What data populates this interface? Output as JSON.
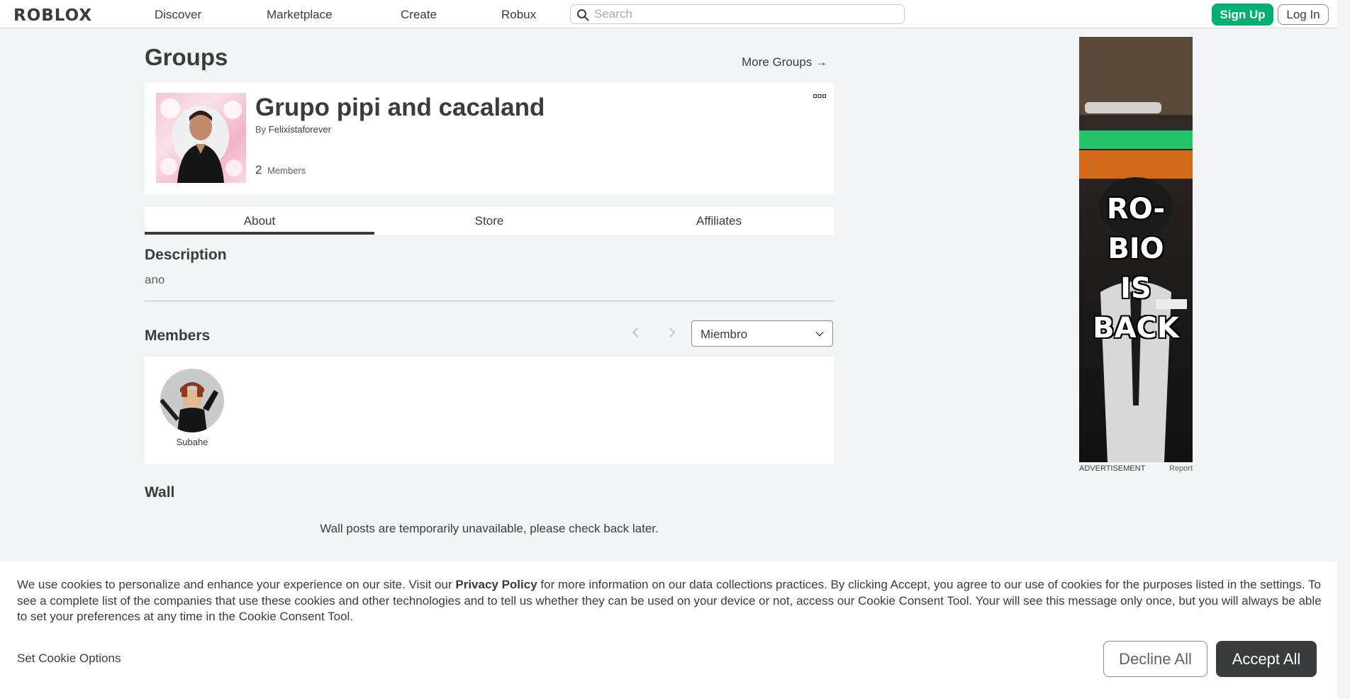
{
  "topnav": {
    "logo_text": "ROBLOX",
    "links": [
      "Discover",
      "Marketplace",
      "Create",
      "Robux"
    ],
    "search_placeholder": "Search",
    "search_value": "",
    "signup_label": "Sign Up",
    "login_label": "Log In"
  },
  "page": {
    "title": "Groups",
    "more_groups_label": "More Groups →"
  },
  "group": {
    "name": "Grupo pipi and cacaland",
    "by_label": "By",
    "owner": "Felixistaforever",
    "member_count": "2",
    "members_label": "Members"
  },
  "tabs": [
    "About",
    "Store",
    "Affiliates"
  ],
  "about": {
    "description_title": "Description",
    "description_text": "ano",
    "members_title": "Members",
    "role_selected": "Miembro",
    "members": [
      {
        "name": "Subahe"
      }
    ],
    "wall_title": "Wall",
    "wall_message": "Wall posts are temporarily unavailable, please check back later."
  },
  "ad": {
    "headline_lines": [
      "RO-BIO",
      "IS",
      "BACK"
    ],
    "label": "ADVERTISEMENT",
    "report": "Report"
  },
  "cookie": {
    "text_pre": "We use cookies to personalize and enhance your experience on our site. Visit our ",
    "privacy_link": "Privacy Policy",
    "text_post": " for more information on our data collections practices. By clicking Accept, you agree to our use of cookies for the purposes listed in the settings. To see a complete list of the companies that use these cookies and other technologies and to tell us whether they can be used on your device or not, access our Cookie Consent Tool. Your will see this message only once, but you will always be able to set your preferences at any time in the Cookie Consent Tool.",
    "set_options_label": "Set Cookie Options",
    "decline_label": "Decline All",
    "accept_label": "Accept All"
  },
  "colors": {
    "accent_green": "#00b06f",
    "text_dark": "#393b3d",
    "background": "#f2f4f5"
  }
}
